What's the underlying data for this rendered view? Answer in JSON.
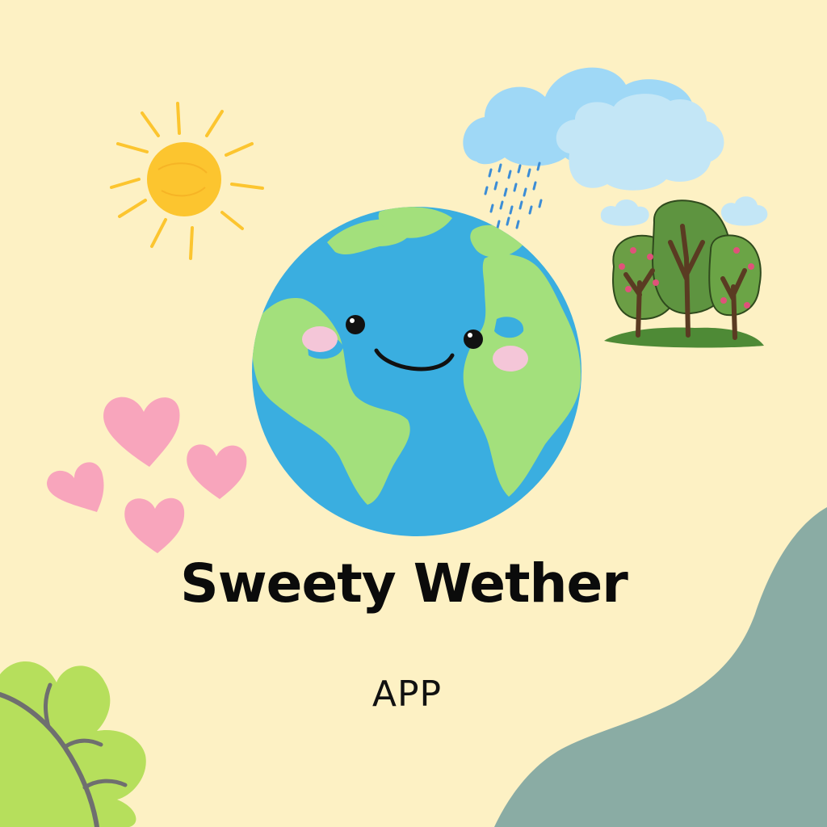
{
  "title": "Sweety Wether",
  "subtitle": "APP",
  "colors": {
    "background": "#fdf1c4",
    "ocean": "#3aaee0",
    "land": "#a3e07c",
    "sun": "#fcc52f",
    "cloud": "#9fd8f6",
    "heart": "#f8a5bc",
    "blob": "#8aaca4",
    "leaf": "#b6df5c"
  },
  "icons": [
    "sun-icon",
    "rain-cloud-icon",
    "trees-icon",
    "earth-icon",
    "hearts-icon",
    "leaf-icon"
  ]
}
